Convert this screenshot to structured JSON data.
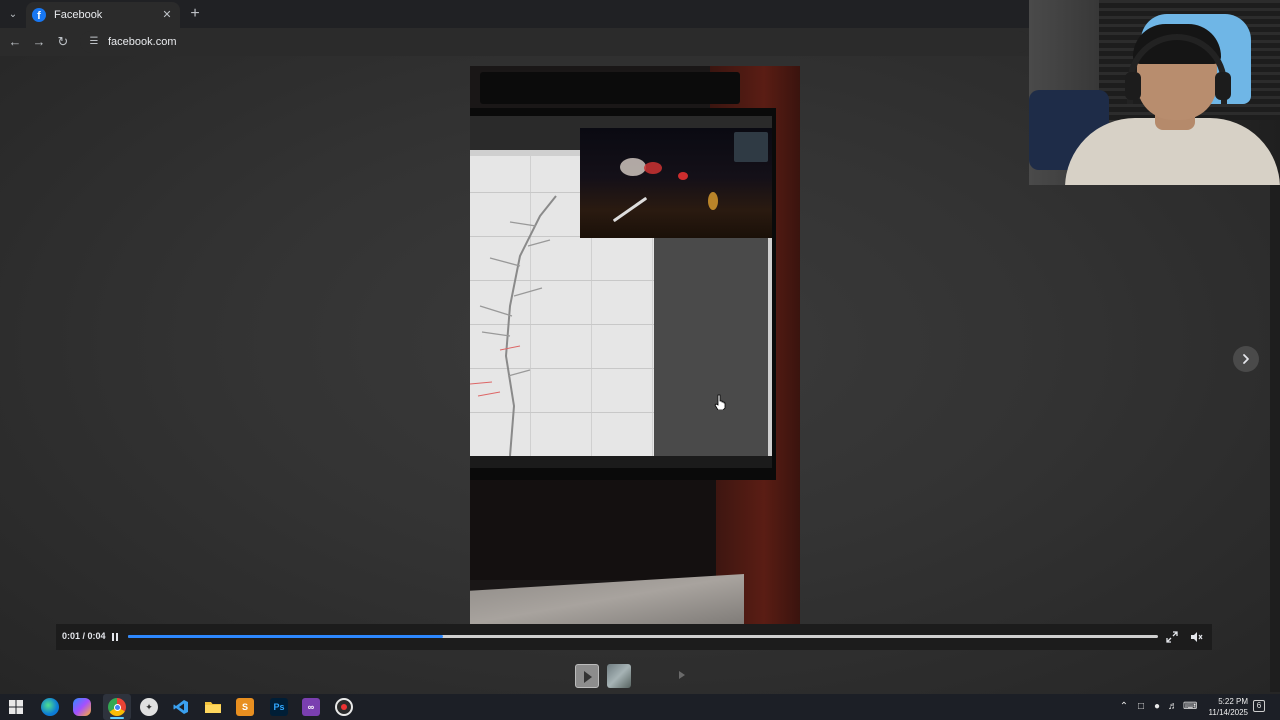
{
  "browser": {
    "tab": {
      "title": "Facebook"
    },
    "address": {
      "url": "facebook.com"
    }
  },
  "player": {
    "time_display": "0:01 / 0:04",
    "progress": 0.306
  },
  "taskbar": {
    "apps": [
      "start",
      "edge",
      "copilot",
      "chrome",
      "app-bird",
      "vscode",
      "file-explorer",
      "sublime-text",
      "photoshop",
      "visual-studio",
      "obs"
    ],
    "active_app": "chrome",
    "time": "5:22 PM",
    "date": "11/14/2025",
    "notification_count": "6"
  },
  "colors": {
    "progress_fill": "#2d88ff",
    "facebook_blue": "#1877f2",
    "taskbar_accent": "#60cdff"
  }
}
